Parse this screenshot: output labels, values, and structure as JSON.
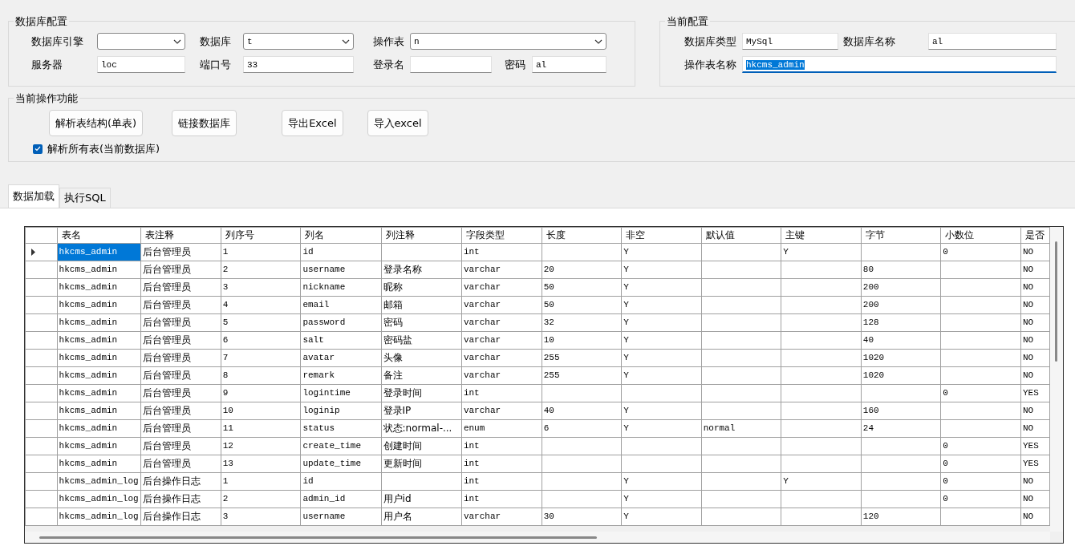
{
  "db_config": {
    "title": "数据库配置",
    "fields": [
      {
        "label": "数据库引擎",
        "kind": "combo"
      },
      {
        "label": "数据库",
        "kind": "combo",
        "value": "t"
      },
      {
        "label": "操作表",
        "kind": "combo",
        "value": "n"
      },
      {
        "label": "服务器",
        "kind": "text",
        "value": "loc"
      },
      {
        "label": "端口号",
        "kind": "text",
        "value": "33"
      },
      {
        "label": "登录名",
        "kind": "text"
      },
      {
        "label": "密码",
        "kind": "text",
        "value": "al"
      }
    ]
  },
  "current_config": {
    "title": "当前配置",
    "fields": [
      {
        "label": "数据库类型",
        "value": "MySql",
        "focused": false
      },
      {
        "label": "数据库名称",
        "value": "al",
        "focused": false
      },
      {
        "label": "操作表名称",
        "value": "hkcms_admin",
        "focused": true
      }
    ]
  },
  "operations": {
    "title": "当前操作功能",
    "buttons": [
      "解析表结构(单表)",
      "链接数据库",
      "导出Excel",
      "导入excel"
    ],
    "checkbox": {
      "label": "解析所有表(当前数据库)",
      "checked": true
    }
  },
  "tabs": [
    {
      "label": "数据加载",
      "selected": true
    },
    {
      "label": "执行SQL",
      "selected": false
    }
  ],
  "table": {
    "columns": [
      "表名",
      "表注释",
      "列序号",
      "列名",
      "列注释",
      "字段类型",
      "长度",
      "非空",
      "默认值",
      "主键",
      "字节",
      "小数位",
      "是否"
    ],
    "rows": [
      {
        "selected": true,
        "cells": [
          "hkcms_admin",
          "后台管理员",
          "1",
          "id",
          "",
          "int",
          "",
          "Y",
          "",
          "Y",
          "",
          "0",
          "NO"
        ]
      },
      {
        "selected": false,
        "cells": [
          "hkcms_admin",
          "后台管理员",
          "2",
          "username",
          "登录名称",
          "varchar",
          "20",
          "Y",
          "",
          "",
          "80",
          "",
          "NO"
        ]
      },
      {
        "selected": false,
        "cells": [
          "hkcms_admin",
          "后台管理员",
          "3",
          "nickname",
          "昵称",
          "varchar",
          "50",
          "Y",
          "",
          "",
          "200",
          "",
          "NO"
        ]
      },
      {
        "selected": false,
        "cells": [
          "hkcms_admin",
          "后台管理员",
          "4",
          "email",
          "邮箱",
          "varchar",
          "50",
          "Y",
          "",
          "",
          "200",
          "",
          "NO"
        ]
      },
      {
        "selected": false,
        "cells": [
          "hkcms_admin",
          "后台管理员",
          "5",
          "password",
          "密码",
          "varchar",
          "32",
          "Y",
          "",
          "",
          "128",
          "",
          "NO"
        ]
      },
      {
        "selected": false,
        "cells": [
          "hkcms_admin",
          "后台管理员",
          "6",
          "salt",
          "密码盐",
          "varchar",
          "10",
          "Y",
          "",
          "",
          "40",
          "",
          "NO"
        ]
      },
      {
        "selected": false,
        "cells": [
          "hkcms_admin",
          "后台管理员",
          "7",
          "avatar",
          "头像",
          "varchar",
          "255",
          "Y",
          "",
          "",
          "1020",
          "",
          "NO"
        ]
      },
      {
        "selected": false,
        "cells": [
          "hkcms_admin",
          "后台管理员",
          "8",
          "remark",
          "备注",
          "varchar",
          "255",
          "Y",
          "",
          "",
          "1020",
          "",
          "NO"
        ]
      },
      {
        "selected": false,
        "cells": [
          "hkcms_admin",
          "后台管理员",
          "9",
          "logintime",
          "登录时间",
          "int",
          "",
          "",
          "",
          "",
          "",
          "0",
          "YES"
        ]
      },
      {
        "selected": false,
        "cells": [
          "hkcms_admin",
          "后台管理员",
          "10",
          "loginip",
          "登录IP",
          "varchar",
          "40",
          "Y",
          "",
          "",
          "160",
          "",
          "NO"
        ]
      },
      {
        "selected": false,
        "cells": [
          "hkcms_admin",
          "后台管理员",
          "11",
          "status",
          "状态:normal-...",
          "enum",
          "6",
          "Y",
          "normal",
          "",
          "24",
          "",
          "NO"
        ]
      },
      {
        "selected": false,
        "cells": [
          "hkcms_admin",
          "后台管理员",
          "12",
          "create_time",
          "创建时间",
          "int",
          "",
          "",
          "",
          "",
          "",
          "0",
          "YES"
        ]
      },
      {
        "selected": false,
        "cells": [
          "hkcms_admin",
          "后台管理员",
          "13",
          "update_time",
          "更新时间",
          "int",
          "",
          "",
          "",
          "",
          "",
          "0",
          "YES"
        ]
      },
      {
        "selected": false,
        "cells": [
          "hkcms_admin_log",
          "后台操作日志",
          "1",
          "id",
          "",
          "int",
          "",
          "Y",
          "",
          "Y",
          "",
          "0",
          "NO"
        ]
      },
      {
        "selected": false,
        "cells": [
          "hkcms_admin_log",
          "后台操作日志",
          "2",
          "admin_id",
          "用户id",
          "int",
          "",
          "Y",
          "",
          "",
          "",
          "0",
          "NO"
        ]
      },
      {
        "selected": false,
        "cells": [
          "hkcms_admin_log",
          "后台操作日志",
          "3",
          "username",
          "用户名",
          "varchar",
          "30",
          "Y",
          "",
          "",
          "120",
          "",
          "NO"
        ]
      }
    ]
  }
}
